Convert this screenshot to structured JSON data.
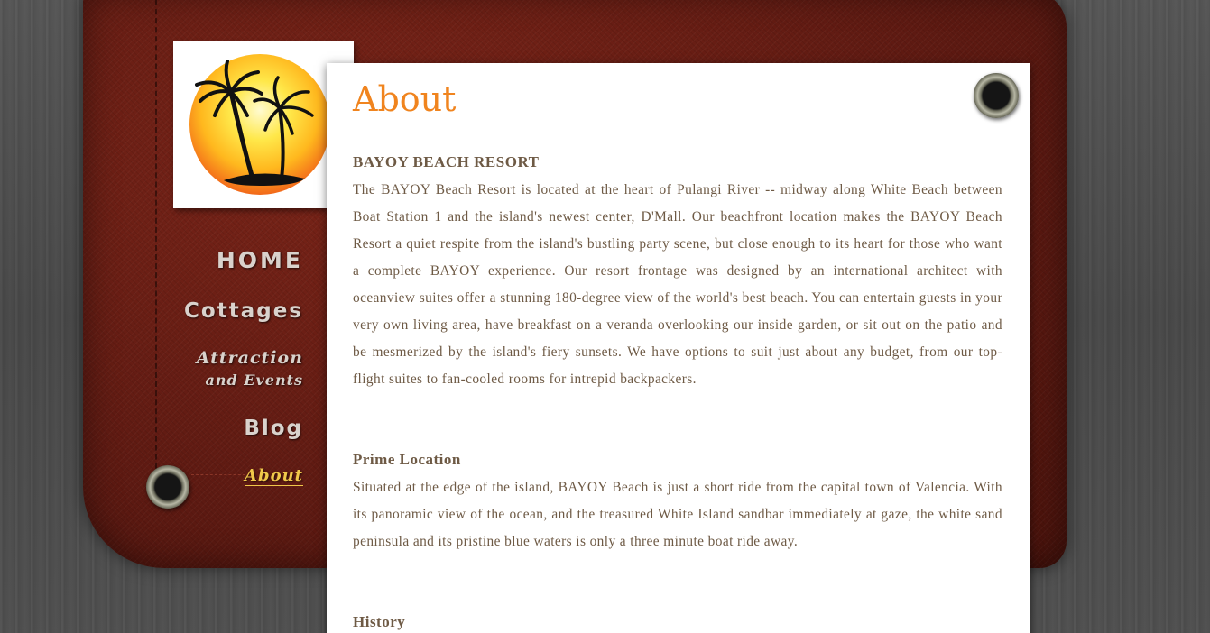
{
  "nav": {
    "home": "HOME",
    "cottages": "Cottages",
    "attraction_line1": "Attraction",
    "attraction_line2": "and Events",
    "blog": "Blog",
    "about": "About"
  },
  "page": {
    "title": "About"
  },
  "sections": [
    {
      "heading": "BAYOY BEACH RESORT",
      "text": "The BAYOY Beach Resort is located at the heart of Pulangi River -- midway along White Beach between Boat Station 1 and the island's newest center, D'Mall. Our beachfront location makes the BAYOY Beach Resort a quiet respite from the island's bustling party scene, but close enough to its heart for those who want a complete BAYOY experience. Our resort frontage was designed by an international architect with oceanview suites offer a stunning 180-degree view of the world's best beach. You can entertain guests in your very own living area, have breakfast on a veranda overlooking our inside garden, or sit out on the patio and be mesmerized by the island's fiery sunsets. We have options to suit just about any budget, from our top-flight suites to fan-cooled rooms for intrepid backpackers."
    },
    {
      "heading": "Prime Location",
      "text": "Situated at the edge of the island, BAYOY Beach is just a short ride from the capital town of Valencia. With its panoramic view of the ocean, and the treasured White Island sandbar immediately at gaze, the white sand peninsula and its pristine blue waters is only a three minute boat ride away."
    },
    {
      "heading": "History"
    }
  ],
  "colors": {
    "accent": "#f0841e",
    "text": "#6e5a45",
    "nav_active": "#f0c84a",
    "cloth": "#6b1e14"
  },
  "icons": [
    "sunset-palm-logo",
    "grommet-icon"
  ]
}
